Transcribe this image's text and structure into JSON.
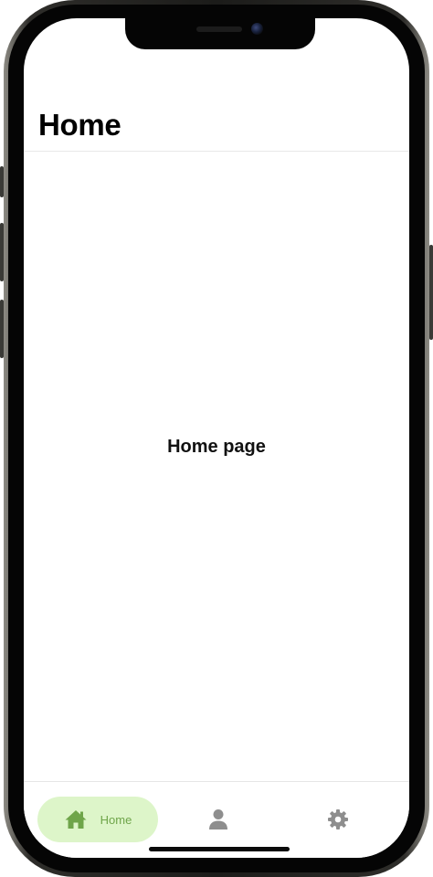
{
  "header": {
    "title": "Home"
  },
  "main": {
    "text": "Home page"
  },
  "tabbar": {
    "active_color": "#6fa54a",
    "active_bg": "#ddf5c9",
    "inactive_color": "#8e8e8e",
    "tabs": [
      {
        "label": "Home",
        "icon": "home-icon",
        "active": true
      },
      {
        "label": "",
        "icon": "person-icon",
        "active": false
      },
      {
        "label": "",
        "icon": "gear-icon",
        "active": false
      }
    ]
  }
}
